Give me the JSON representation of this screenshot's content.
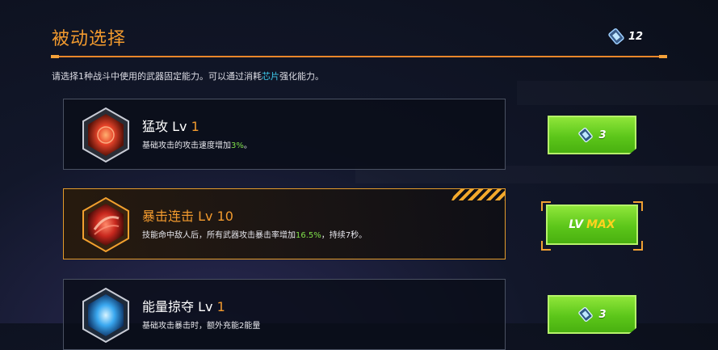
{
  "header": {
    "title": "被动选择",
    "chip_count": "12"
  },
  "description": {
    "before": "请选择1种战斗中使用的武器固定能力。可以通过消耗",
    "highlight": "芯片",
    "after": "强化能力。"
  },
  "skills": [
    {
      "name": "猛攻",
      "lv_label": "Lv",
      "level": "1",
      "desc_before": "基础攻击的攻击速度增加",
      "desc_value": "3%",
      "desc_after": "。",
      "cost": "3",
      "icon_color": "#e8442a"
    },
    {
      "name": "暴击连击",
      "lv_label": "Lv",
      "level": "10",
      "desc_before": "技能命中敌人后，所有武器攻击暴击率增加",
      "desc_value": "16.5%",
      "desc_after": "，持续7秒。",
      "max_lv": "LV",
      "max_text": "MAX",
      "icon_color": "#c8281e"
    },
    {
      "name": "能量掠夺",
      "lv_label": "Lv",
      "level": "1",
      "desc_before": "基础攻击暴击时，额外充能2能量",
      "desc_value": "",
      "desc_after": "",
      "cost": "3",
      "icon_color": "#3aa8f0"
    }
  ],
  "colors": {
    "accent": "#f29a2e",
    "button_green": "#5cc61a",
    "highlight_blue": "#3ec7e8",
    "value_green": "#7fe04a"
  }
}
